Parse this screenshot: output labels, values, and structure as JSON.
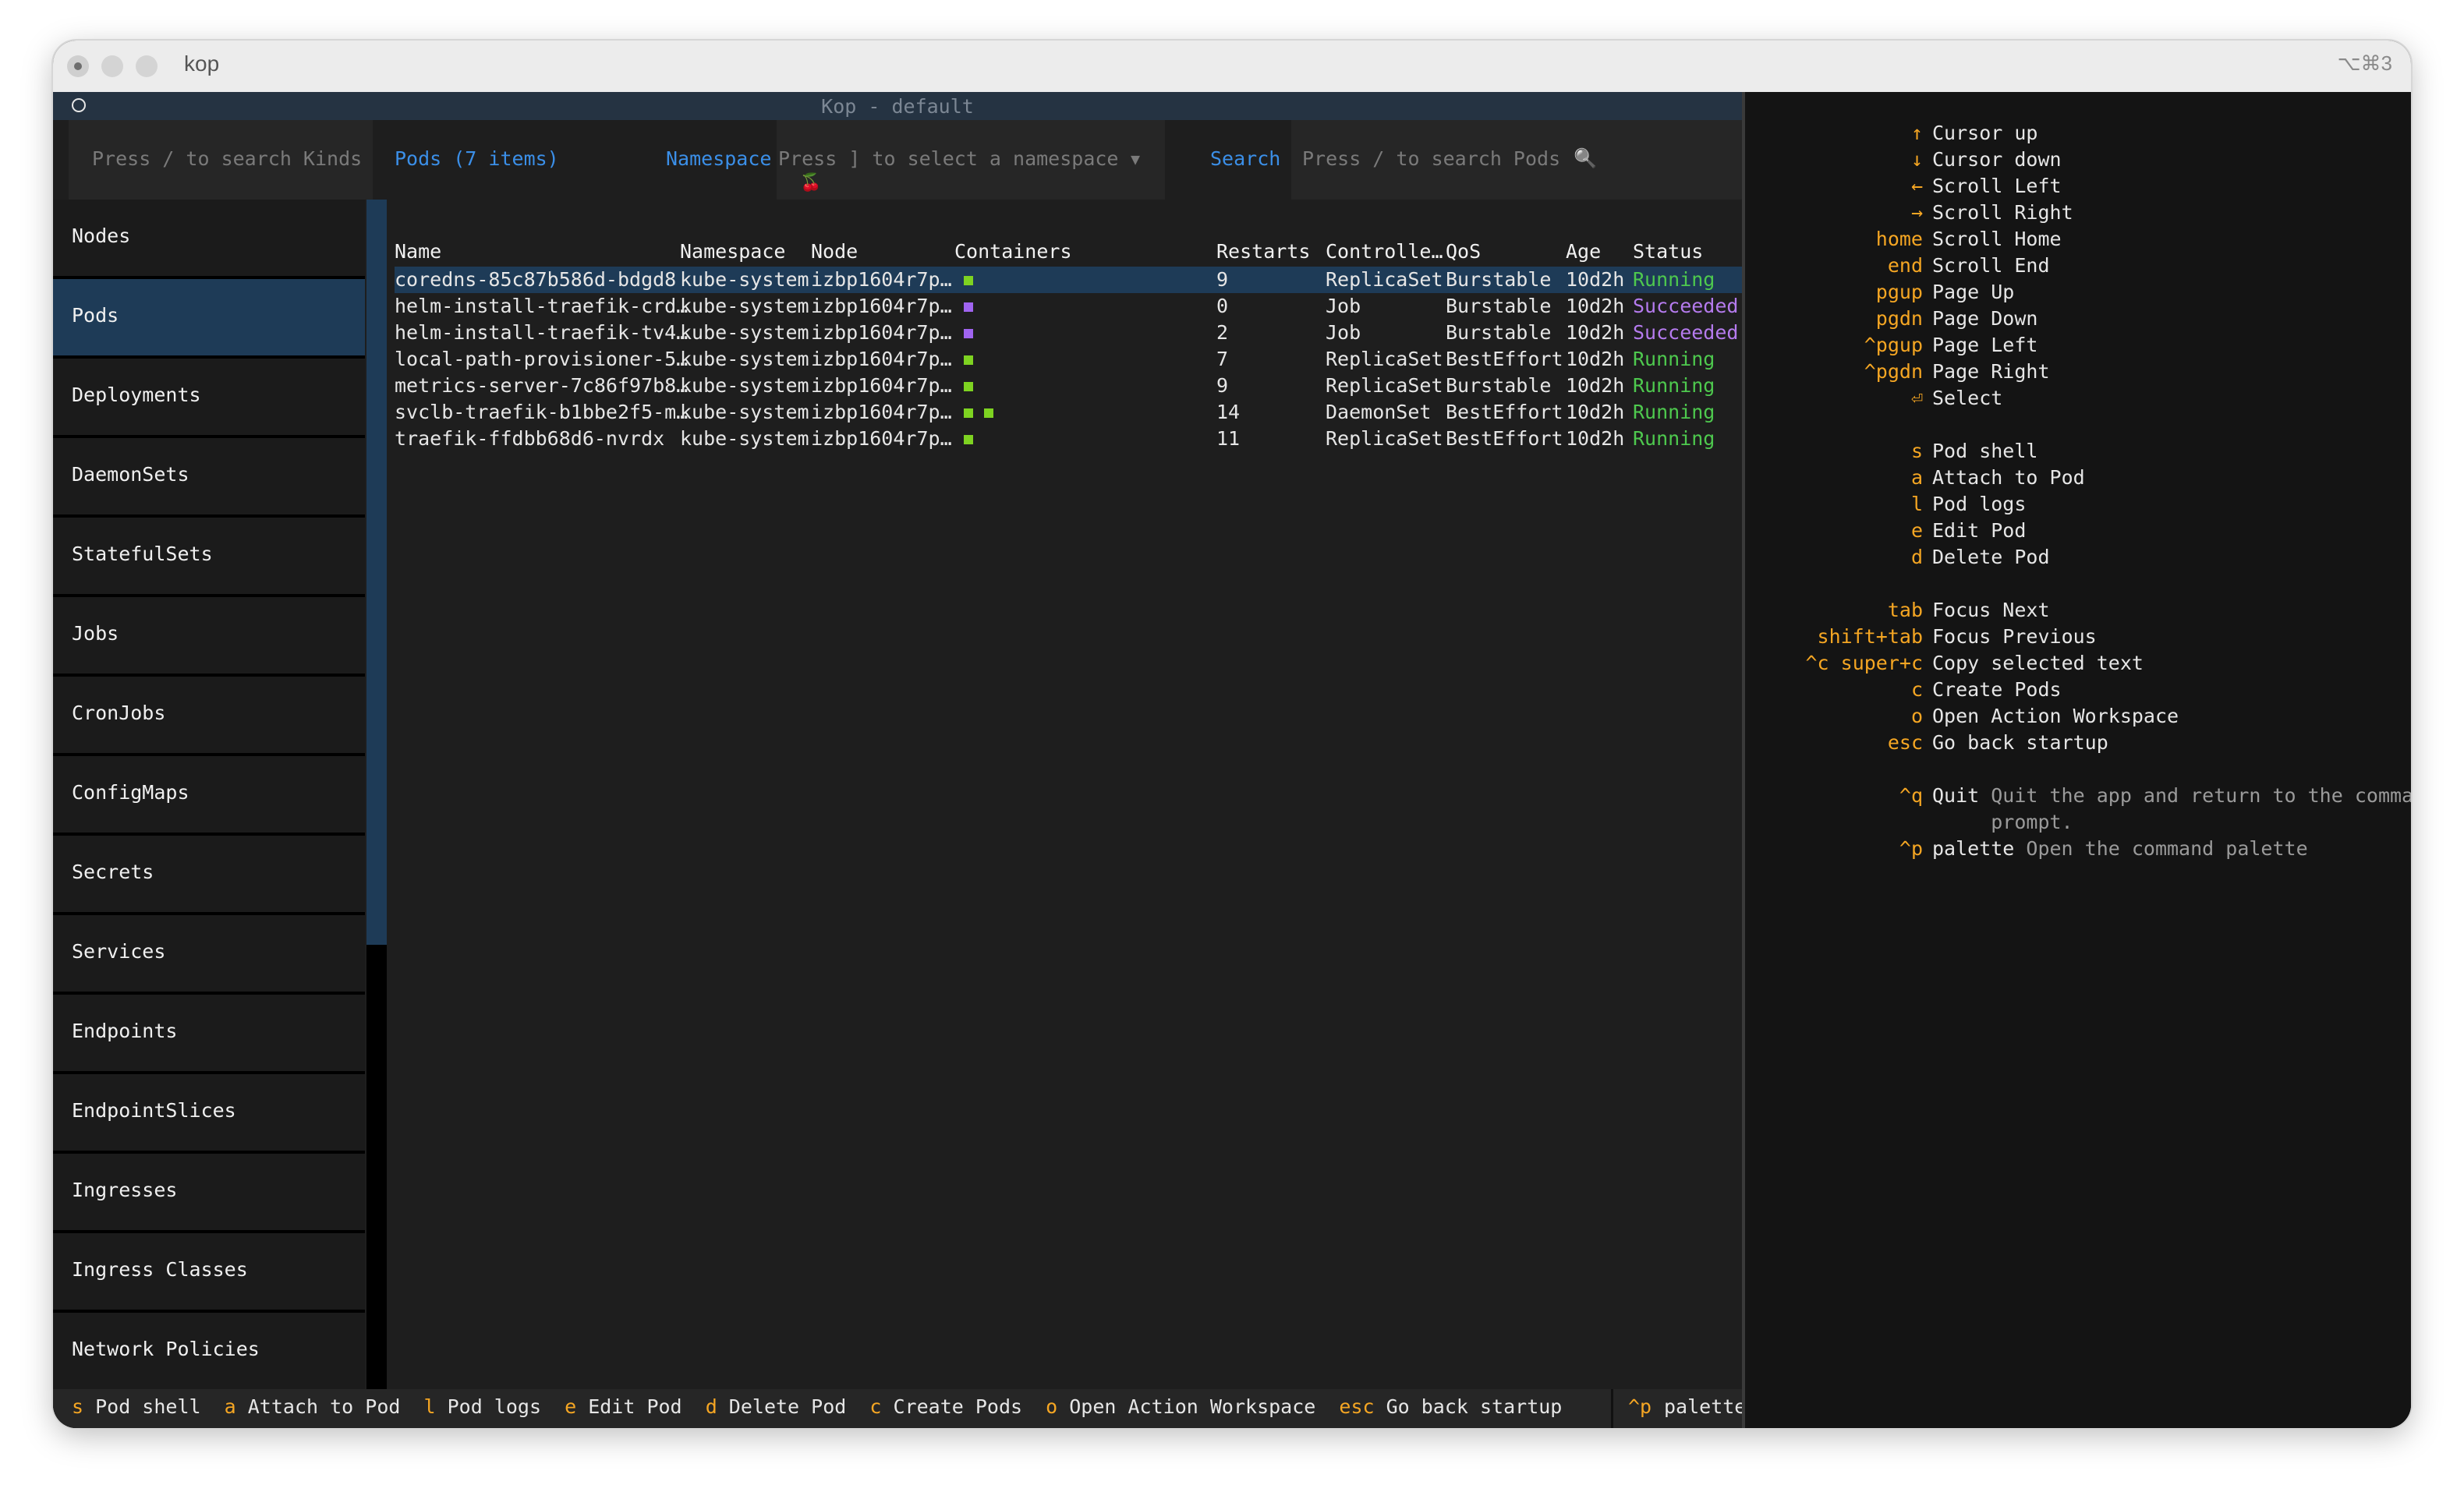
{
  "window": {
    "app_title": "kop",
    "shortcut_hint": "⌥⌘3"
  },
  "header": {
    "title": "Kop - default"
  },
  "kinds_search": {
    "placeholder": "Press / to search Kinds"
  },
  "pods_label": "Pods (7 items)",
  "namespace": {
    "label": "Namespace",
    "placeholder": "Press ] to select a namespace",
    "caret": "▼",
    "icon": "🍒"
  },
  "search": {
    "label": "Search",
    "placeholder": "Press / to search Pods",
    "icon": "🔍"
  },
  "sidebar": {
    "items": [
      {
        "label": "Nodes"
      },
      {
        "label": "Pods",
        "active": true
      },
      {
        "label": "Deployments"
      },
      {
        "label": "DaemonSets"
      },
      {
        "label": "StatefulSets"
      },
      {
        "label": "Jobs"
      },
      {
        "label": "CronJobs"
      },
      {
        "label": "ConfigMaps"
      },
      {
        "label": "Secrets"
      },
      {
        "label": "Services"
      },
      {
        "label": "Endpoints"
      },
      {
        "label": "EndpointSlices"
      },
      {
        "label": "Ingresses"
      },
      {
        "label": "Ingress Classes"
      },
      {
        "label": "Network Policies"
      }
    ]
  },
  "table": {
    "columns": [
      "Name",
      "Namespace",
      "Node",
      "Containers",
      "Restarts",
      "Controlle…",
      "QoS",
      "Age",
      "Status"
    ],
    "rows": [
      {
        "name": "coredns-85c87b586d-bdgd8",
        "namespace": "kube-system",
        "node": "izbp1604r7p…",
        "containers": [
          "green"
        ],
        "restarts": "9",
        "controller": "ReplicaSet",
        "qos": "Burstable",
        "age": "10d2h",
        "status": "Running",
        "status_color": "#4ec94e"
      },
      {
        "name": "helm-install-traefik-crd…",
        "namespace": "kube-system",
        "node": "izbp1604r7p…",
        "containers": [
          "purple"
        ],
        "restarts": "0",
        "controller": "Job",
        "qos": "Burstable",
        "age": "10d2h",
        "status": "Succeeded",
        "status_color": "#b57bee"
      },
      {
        "name": "helm-install-traefik-tv4…",
        "namespace": "kube-system",
        "node": "izbp1604r7p…",
        "containers": [
          "purple"
        ],
        "restarts": "2",
        "controller": "Job",
        "qos": "Burstable",
        "age": "10d2h",
        "status": "Succeeded",
        "status_color": "#b57bee"
      },
      {
        "name": "local-path-provisioner-5…",
        "namespace": "kube-system",
        "node": "izbp1604r7p…",
        "containers": [
          "green"
        ],
        "restarts": "7",
        "controller": "ReplicaSet",
        "qos": "BestEffort",
        "age": "10d2h",
        "status": "Running",
        "status_color": "#4ec94e"
      },
      {
        "name": "metrics-server-7c86f97b8…",
        "namespace": "kube-system",
        "node": "izbp1604r7p…",
        "containers": [
          "green"
        ],
        "restarts": "9",
        "controller": "ReplicaSet",
        "qos": "Burstable",
        "age": "10d2h",
        "status": "Running",
        "status_color": "#4ec94e"
      },
      {
        "name": "svclb-traefik-b1bbe2f5-m…",
        "namespace": "kube-system",
        "node": "izbp1604r7p…",
        "containers": [
          "green",
          "green"
        ],
        "restarts": "14",
        "controller": "DaemonSet",
        "qos": "BestEffort",
        "age": "10d2h",
        "status": "Running",
        "status_color": "#4ec94e"
      },
      {
        "name": "traefik-ffdbb68d6-nvrdx",
        "namespace": "kube-system",
        "node": "izbp1604r7p…",
        "containers": [
          "green"
        ],
        "restarts": "11",
        "controller": "ReplicaSet",
        "qos": "BestEffort",
        "age": "10d2h",
        "status": "Running",
        "status_color": "#4ec94e"
      }
    ]
  },
  "footer": {
    "items": [
      {
        "key": "s",
        "desc": "Pod shell"
      },
      {
        "key": "a",
        "desc": "Attach to Pod"
      },
      {
        "key": "l",
        "desc": "Pod logs"
      },
      {
        "key": "e",
        "desc": "Edit Pod"
      },
      {
        "key": "d",
        "desc": "Delete Pod"
      },
      {
        "key": "c",
        "desc": "Create Pods"
      },
      {
        "key": "o",
        "desc": "Open Action Workspace"
      },
      {
        "key": "esc",
        "desc": "Go back startup"
      }
    ],
    "palette": {
      "key": "^p",
      "desc": "palette"
    }
  },
  "help": {
    "groups": [
      [
        {
          "key": "↑",
          "desc": "Cursor up"
        },
        {
          "key": "↓",
          "desc": "Cursor down"
        },
        {
          "key": "←",
          "desc": "Scroll Left"
        },
        {
          "key": "→",
          "desc": "Scroll Right"
        },
        {
          "key": "home",
          "desc": "Scroll Home"
        },
        {
          "key": "end",
          "desc": "Scroll End"
        },
        {
          "key": "pgup",
          "desc": "Page Up"
        },
        {
          "key": "pgdn",
          "desc": "Page Down"
        },
        {
          "key": "^pgup",
          "desc": "Page Left"
        },
        {
          "key": "^pgdn",
          "desc": "Page Right"
        },
        {
          "key": "⏎",
          "desc": "Select"
        }
      ],
      [
        {
          "key": "s",
          "desc": "Pod shell"
        },
        {
          "key": "a",
          "desc": "Attach to Pod"
        },
        {
          "key": "l",
          "desc": "Pod logs"
        },
        {
          "key": "e",
          "desc": "Edit Pod"
        },
        {
          "key": "d",
          "desc": "Delete Pod"
        }
      ],
      [
        {
          "key": "tab",
          "desc": "Focus Next"
        },
        {
          "key": "shift+tab",
          "desc": "Focus Previous"
        },
        {
          "key": "^c super+c",
          "desc": "Copy selected text"
        },
        {
          "key": "c",
          "desc": "Create Pods"
        },
        {
          "key": "o",
          "desc": "Open Action Workspace"
        },
        {
          "key": "esc",
          "desc": "Go back startup"
        }
      ],
      [
        {
          "key": "^q",
          "desc": "Quit",
          "extra": "Quit the app and return to the command",
          "extra2": "prompt."
        },
        {
          "key": "^p",
          "desc": "palette",
          "extra": "Open the command palette"
        }
      ]
    ]
  },
  "colors": {
    "accent_blue": "#3b8fe8",
    "key_orange": "#f5a623",
    "container_green": "#7ed321",
    "container_purple": "#a064f0",
    "selection": "#1e3b57"
  }
}
